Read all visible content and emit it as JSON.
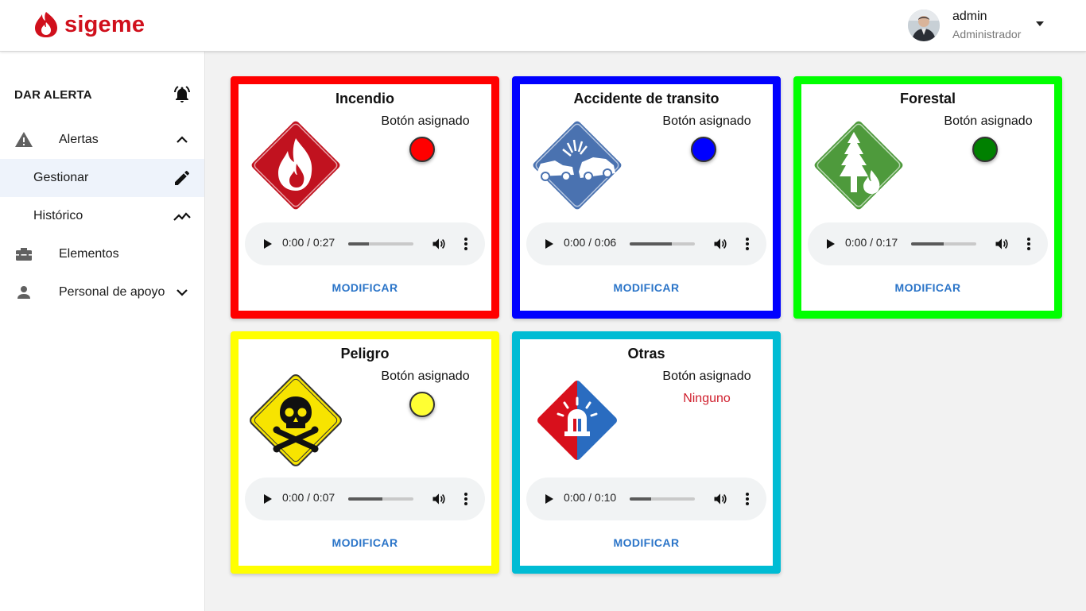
{
  "header": {
    "logo_text": "sigeme",
    "user_name": "admin",
    "user_role": "Administrador"
  },
  "sidebar": {
    "title": "DAR ALERTA",
    "items": [
      {
        "label": "Alertas",
        "icon": "warning-icon",
        "state": "expanded"
      },
      {
        "label": "Gestionar",
        "icon": "pencil-icon",
        "selected": true
      },
      {
        "label": "Histórico",
        "icon": "trending-icon"
      },
      {
        "label": "Elementos",
        "icon": "toolbox-icon"
      },
      {
        "label": "Personal de apoyo",
        "icon": "person-icon",
        "state": "collapsed"
      }
    ]
  },
  "labels": {
    "assigned": "Botón asignado",
    "modify": "MODIFICAR"
  },
  "cards": [
    {
      "title": "Incendio",
      "border_color": "#ff0000",
      "button_color": "#ff0000",
      "assigned": null,
      "sign": "fire-sign-icon",
      "audio_time": "0:00 / 0:27",
      "audio_progress": 0.32
    },
    {
      "title": "Accidente de transito",
      "border_color": "#0000ff",
      "button_color": "#0000ff",
      "assigned": null,
      "sign": "car-crash-sign-icon",
      "audio_time": "0:00 / 0:06",
      "audio_progress": 0.65
    },
    {
      "title": "Forestal",
      "border_color": "#00ff00",
      "button_color": "#008000",
      "assigned": null,
      "sign": "forest-fire-sign-icon",
      "audio_time": "0:00 / 0:17",
      "audio_progress": 0.5
    },
    {
      "title": "Peligro",
      "border_color": "#ffff00",
      "button_color": "#ffff33",
      "assigned": null,
      "sign": "skull-sign-icon",
      "audio_time": "0:00 / 0:07",
      "audio_progress": 0.52
    },
    {
      "title": "Otras",
      "border_color": "#00bcd4",
      "button_color": null,
      "assigned": "Ninguno",
      "sign": "siren-sign-icon",
      "audio_time": "0:00 / 0:10",
      "audio_progress": 0.33
    }
  ]
}
